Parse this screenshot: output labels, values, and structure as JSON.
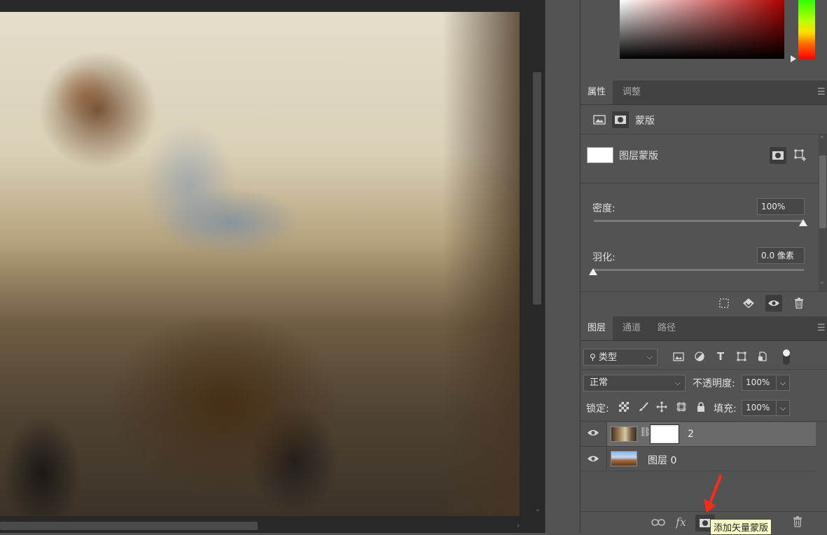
{
  "properties_panel": {
    "tabs": [
      {
        "label": "属性",
        "active": true
      },
      {
        "label": "调整",
        "active": false
      }
    ],
    "mask_type_label": "蒙版",
    "layer_mask_label": "图层蒙版",
    "density": {
      "label": "密度:",
      "value": "100%",
      "level": 1.0
    },
    "feather": {
      "label": "羽化:",
      "value": "0.0 像素",
      "level": 0.0
    }
  },
  "layers_panel": {
    "tabs": [
      {
        "label": "图层",
        "active": true
      },
      {
        "label": "通道",
        "active": false
      },
      {
        "label": "路径",
        "active": false
      }
    ],
    "filter_kind": "类型",
    "blend_mode": "正常",
    "opacity": {
      "label": "不透明度:",
      "value": "100%"
    },
    "lock_label": "锁定:",
    "fill": {
      "label": "填充:",
      "value": "100%"
    },
    "layers": [
      {
        "name": "2",
        "visible": true,
        "selected": true,
        "has_mask": true
      },
      {
        "name": "图层 0",
        "visible": true,
        "selected": false,
        "has_mask": false
      }
    ],
    "tooltip": "添加矢量蒙版",
    "fx_label": "fx"
  },
  "colors": {
    "panel_bg": "#535353",
    "tab_bar_bg": "#424242",
    "canvas_bg": "#282828",
    "arrow_annotation": "#ff2a1a",
    "tooltip_bg": "#fefec8"
  }
}
